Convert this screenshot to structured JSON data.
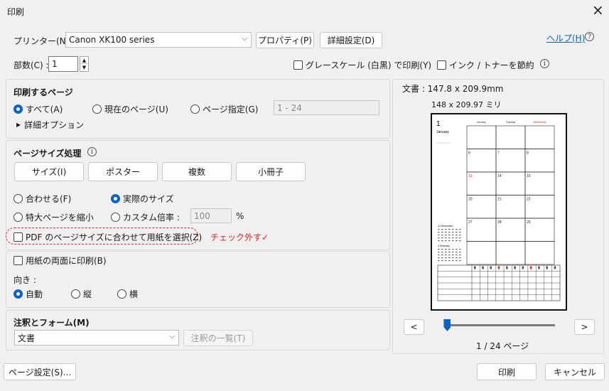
{
  "window": {
    "title": "印刷",
    "close_glyph": "×"
  },
  "printer": {
    "label": "プリンター(N) :",
    "value": "Canon XK100 series",
    "properties": "プロパティ(P)",
    "advanced": "詳細設定(D)",
    "help": "ヘルプ(H)"
  },
  "copies": {
    "label": "部数(C) :",
    "value": "1"
  },
  "options": {
    "grayscale": "グレースケール (白黒) で印刷(Y)",
    "save_ink": "インク / トナーを節約"
  },
  "pages": {
    "title": "印刷するページ",
    "all": "すべて(A)",
    "current": "現在のページ(U)",
    "range": "ページ指定(G)",
    "range_placeholder": "1 - 24",
    "more": "詳細オプション"
  },
  "sizing": {
    "title": "ページサイズ処理",
    "size": "サイズ(I)",
    "poster": "ポスター",
    "multiple": "複数",
    "booklet": "小冊子",
    "fit": "合わせる(F)",
    "actual": "実際のサイズ",
    "shrink": "特大ページを縮小",
    "custom": "カスタム倍率 :",
    "custom_value": "100",
    "percent": "%",
    "pdf_paper": "PDF のページサイズに合わせて用紙を選択(Z)",
    "annotation": "チェック外す✓"
  },
  "duplex": {
    "label": "用紙の両面に印刷(B)"
  },
  "orientation": {
    "title": "向き :",
    "auto": "自動",
    "portrait": "縦",
    "landscape": "横"
  },
  "comments": {
    "title": "注釈とフォーム(M)",
    "value": "文書",
    "summary": "注釈の一覧(T)"
  },
  "preview": {
    "doc_size": "文書 : 147.8 x 209.9mm",
    "paper_size": "148 x 209.97 ミリ",
    "page_indicator": "1 / 24 ページ",
    "prev": "<",
    "next": ">",
    "page_progress": 0.04,
    "cal": {
      "month_num": "1",
      "month_name": "January",
      "days": [
        "Monday",
        "Tuesday",
        "Wednesday"
      ],
      "numbers": [
        "6",
        "7",
        "8",
        "13",
        "14",
        "15",
        "20",
        "21",
        "22",
        "27",
        "28",
        "29"
      ],
      "mini1": "12 December",
      "mini2": "2 February"
    }
  },
  "footer": {
    "page_setup": "ページ設定(S)...",
    "print": "印刷",
    "cancel": "キャンセル"
  },
  "colors": {
    "accent": "#0a64c8",
    "annotation_red": "#e0282a",
    "link": "#0a5fc5"
  }
}
